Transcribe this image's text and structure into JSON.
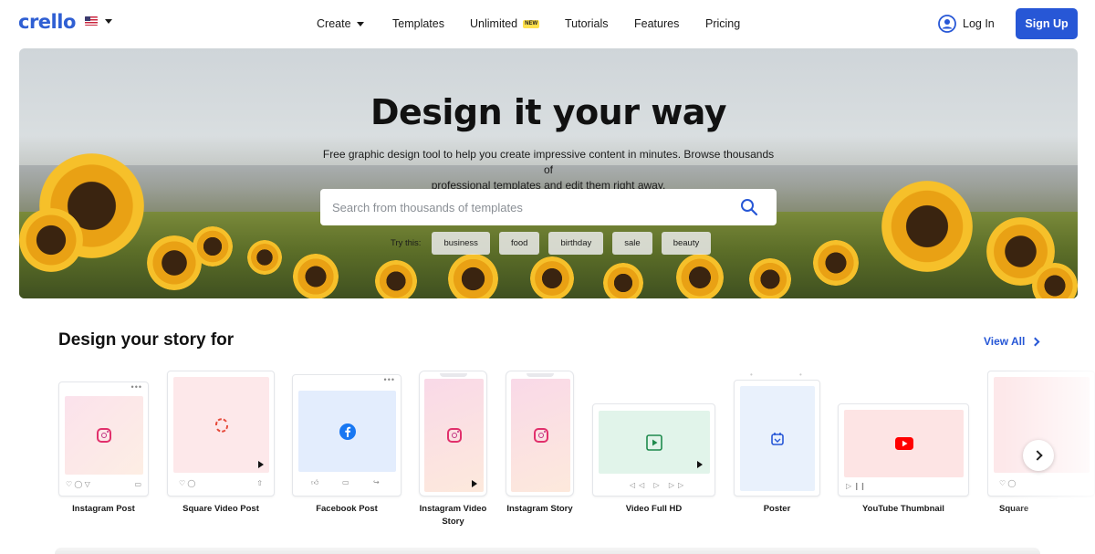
{
  "header": {
    "logo": "crello",
    "language_icon": "us-flag-icon",
    "nav": [
      {
        "label": "Create",
        "has_dropdown": true
      },
      {
        "label": "Templates"
      },
      {
        "label": "Unlimited",
        "badge": "NEW"
      },
      {
        "label": "Tutorials"
      },
      {
        "label": "Features"
      },
      {
        "label": "Pricing"
      }
    ],
    "login_label": "Log In",
    "signup_label": "Sign Up"
  },
  "hero": {
    "title": "Design it your way",
    "subtitle_line1": "Free graphic design tool to help you create impressive content in minutes. Browse thousands of",
    "subtitle_line2": "professional templates and edit them right away.",
    "search_placeholder": "Search from thousands of templates",
    "try_label": "Try this:",
    "suggestions": [
      "business",
      "food",
      "birthday",
      "sale",
      "beauty"
    ]
  },
  "stories": {
    "title": "Design your story for",
    "view_all": "View All",
    "items": [
      {
        "label": "Instagram Post",
        "icon": "instagram-icon"
      },
      {
        "label": "Square Video Post",
        "icon": "refresh-arrows-icon"
      },
      {
        "label": "Facebook Post",
        "icon": "facebook-icon"
      },
      {
        "label_line1": "Instagram Video",
        "label_line2": "Story",
        "icon": "instagram-icon"
      },
      {
        "label": "Instagram Story",
        "icon": "instagram-icon"
      },
      {
        "label": "Video Full HD",
        "icon": "video-play-icon"
      },
      {
        "label": "Poster",
        "icon": "poster-icon"
      },
      {
        "label": "YouTube Thumbnail",
        "icon": "youtube-icon"
      },
      {
        "label": "Square",
        "icon": "instagram-icon"
      }
    ]
  },
  "colors": {
    "brand": "#2f5fd3",
    "primary_button": "#2757d6",
    "new_badge": "#ffe14d"
  }
}
